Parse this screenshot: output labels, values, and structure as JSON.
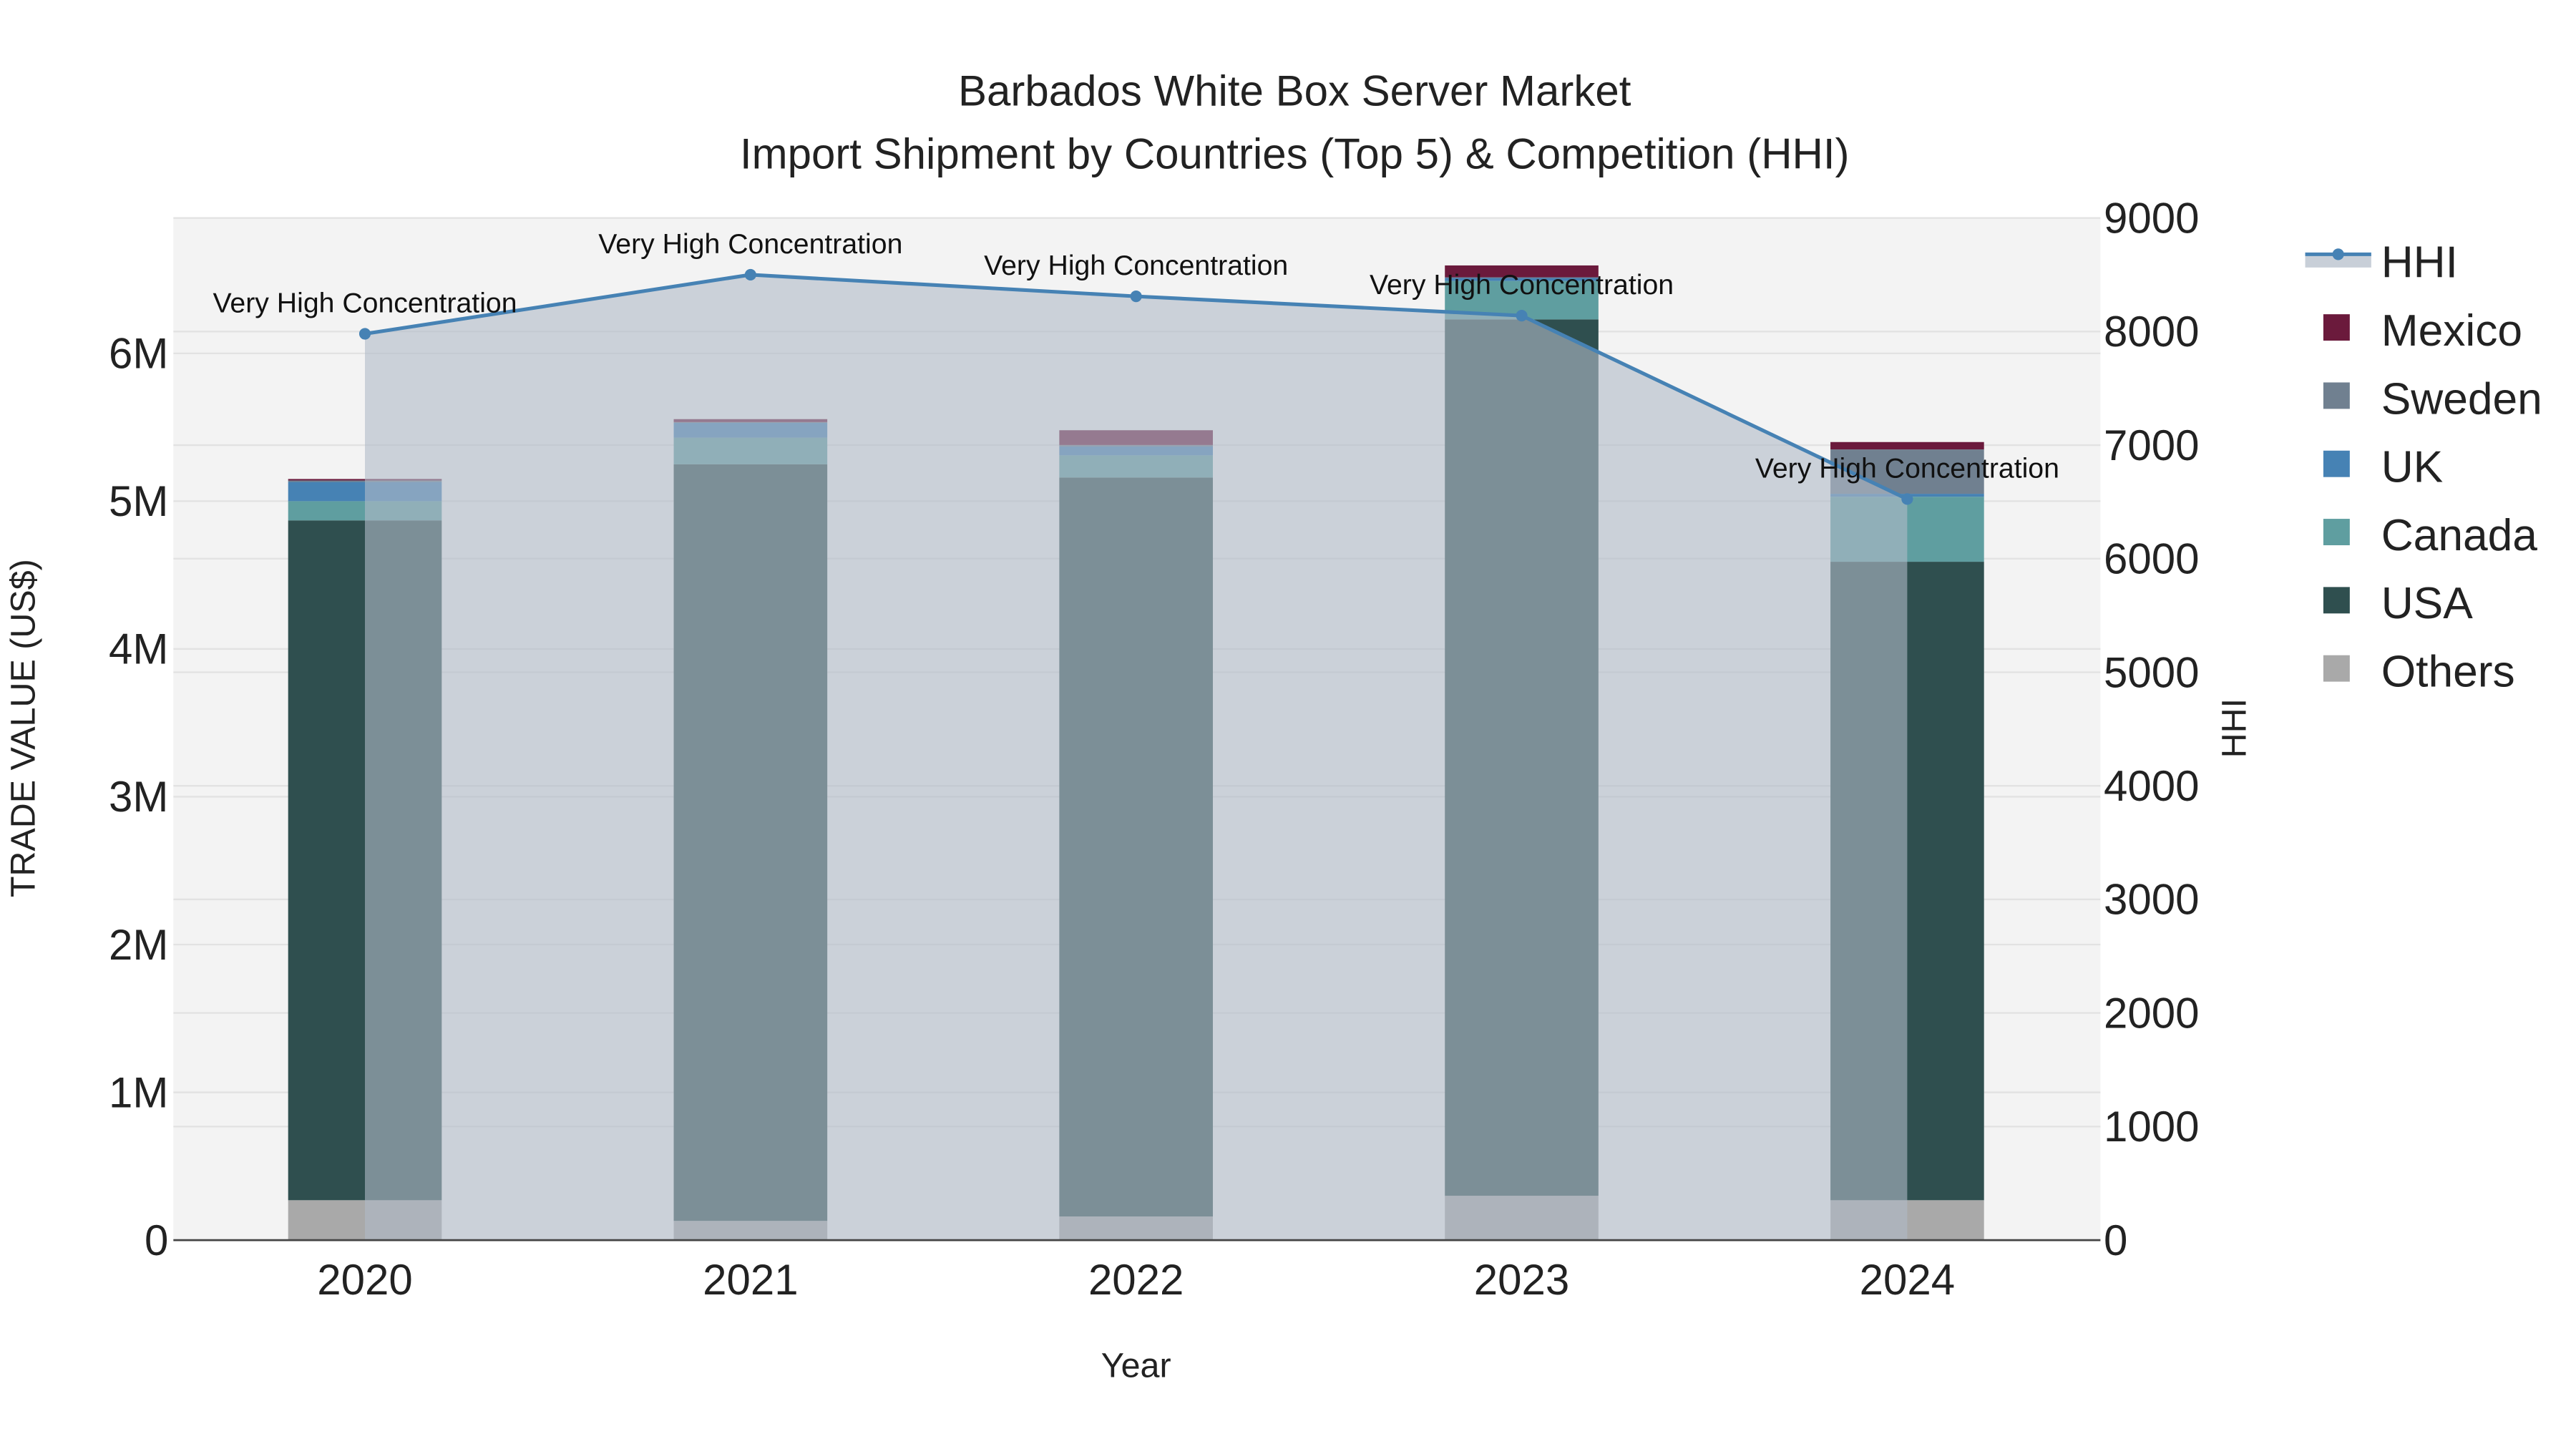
{
  "chart_data": {
    "type": "bar",
    "barmode": "stack",
    "title_line1": "Barbados White Box Server Market",
    "title_line2": "Import Shipment by Countries (Top 5) & Competition (HHI)",
    "xlabel": "Year",
    "ylabel": "TRADE VALUE (US$)",
    "y2label": "HHI",
    "categories": [
      "2020",
      "2021",
      "2022",
      "2023",
      "2024"
    ],
    "ylim": [
      0,
      6900000
    ],
    "y_ticks": [
      0,
      1000000,
      2000000,
      3000000,
      4000000,
      5000000,
      6000000
    ],
    "y_tick_labels": [
      "0",
      "1M",
      "2M",
      "3M",
      "4M",
      "5M",
      "6M"
    ],
    "y2lim": [
      0,
      9000
    ],
    "y2_ticks": [
      0,
      1000,
      2000,
      3000,
      4000,
      5000,
      6000,
      7000,
      8000,
      9000
    ],
    "y2_tick_labels": [
      "0",
      "1000",
      "2000",
      "3000",
      "4000",
      "5000",
      "6000",
      "7000",
      "8000",
      "9000"
    ],
    "series": [
      {
        "name": "Others",
        "color": "#a9a9a9",
        "values": [
          270000,
          130000,
          160000,
          300000,
          270000
        ]
      },
      {
        "name": "USA",
        "color": "#2f4f4f",
        "values": [
          4600000,
          5120000,
          5000000,
          5930000,
          4320000
        ]
      },
      {
        "name": "Canada",
        "color": "#5f9ea0",
        "values": [
          130000,
          180000,
          150000,
          260000,
          440000
        ]
      },
      {
        "name": "UK",
        "color": "#4682b4",
        "values": [
          130000,
          100000,
          60000,
          20000,
          20000
        ]
      },
      {
        "name": "Sweden",
        "color": "#708090",
        "values": [
          10000,
          5000,
          10000,
          5000,
          300000
        ]
      },
      {
        "name": "Mexico",
        "color": "#6b1a3c",
        "values": [
          10000,
          20000,
          100000,
          80000,
          50000
        ]
      }
    ],
    "hhi": {
      "name": "HHI",
      "color": "#4682b4",
      "values": [
        7980,
        8500,
        8310,
        8140,
        6525
      ],
      "annotations": [
        "Very High Concentration",
        "Very High Concentration",
        "Very High Concentration",
        "Very High Concentration",
        "Very High Concentration"
      ]
    },
    "legend": [
      "HHI",
      "Mexico",
      "Sweden",
      "UK",
      "Canada",
      "USA",
      "Others"
    ],
    "legend_placement": "right",
    "grid": true
  }
}
